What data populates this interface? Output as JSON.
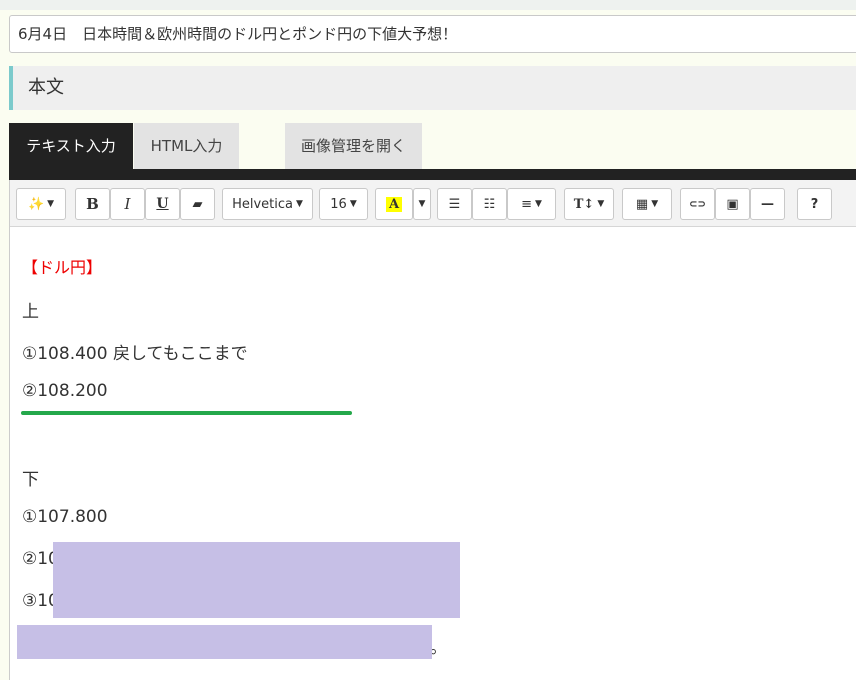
{
  "post": {
    "title": "6月4日　日本時間＆欧州時間のドル円とポンド円の下値大予想！"
  },
  "section": {
    "label": "本文"
  },
  "tabs": {
    "text": "テキスト入力",
    "html": "HTML入力",
    "image": "画像管理を開く"
  },
  "toolbar": {
    "magic": "✨",
    "bold": "B",
    "italic": "I",
    "underline": "U",
    "eraser": "▰",
    "font_name": "Helvetica",
    "font_size": "16",
    "highlight": "A",
    "ul": "☰",
    "ol": "☷",
    "align": "≡",
    "text_size": "T↕",
    "table": "▦",
    "link": "⊂⊃",
    "image": "▣",
    "hr": "—",
    "help": "?"
  },
  "content": {
    "heading": "【ドル円】",
    "up_label": "上",
    "up_1": "①108.400 戻してもここまで",
    "up_2": "②108.200",
    "down_label": "下",
    "down_1": "①107.800",
    "down_2": "②10",
    "down_3": "③10",
    "trail": "。"
  }
}
